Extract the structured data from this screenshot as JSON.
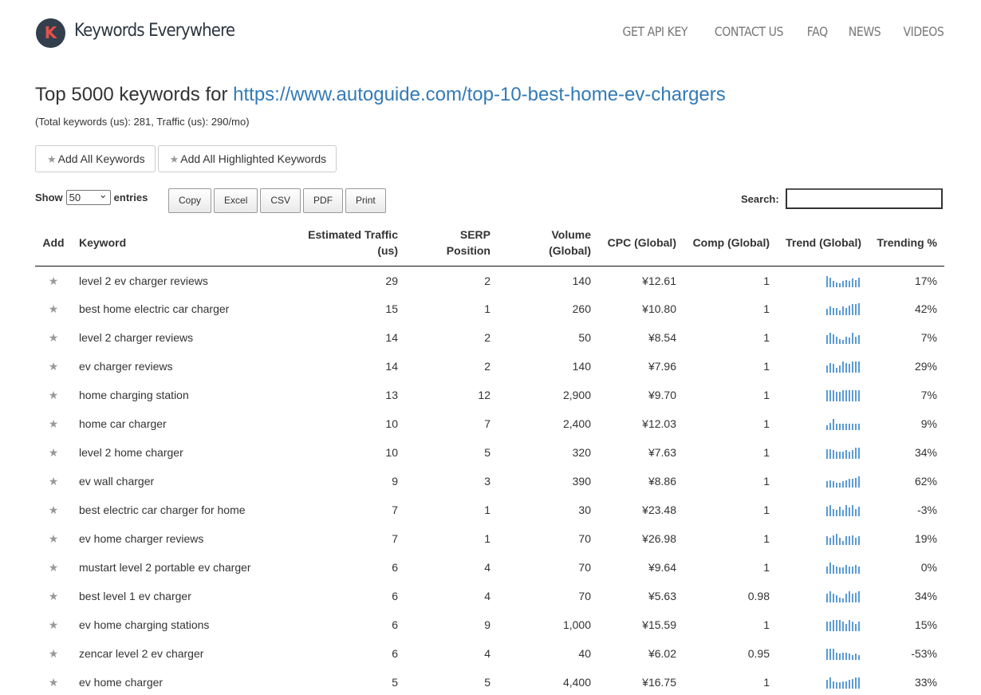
{
  "header": {
    "logo_letter": "K",
    "brand": "Keywords Everywhere",
    "nav": [
      "GET API KEY",
      "CONTACT US",
      "FAQ",
      "NEWS",
      "VIDEOS"
    ]
  },
  "title": {
    "prefix": "Top 5000 keywords for",
    "url": "https://www.autoguide.com/top-10-best-home-ev-chargers"
  },
  "subtitle": "(Total keywords (us): 281, Traffic (us): 290/mo)",
  "buttons": {
    "add_all": "Add All Keywords",
    "add_highlighted": "Add All Highlighted Keywords"
  },
  "show": {
    "prefix": "Show",
    "value": "50",
    "suffix": "entries"
  },
  "exports": [
    "Copy",
    "Excel",
    "CSV",
    "PDF",
    "Print"
  ],
  "search": {
    "label": "Search:",
    "value": ""
  },
  "table": {
    "headers": {
      "add": "Add",
      "keyword": "Keyword",
      "traffic_1": "Estimated Traffic",
      "traffic_2": "(us)",
      "serp_1": "SERP",
      "serp_2": "Position",
      "volume_1": "Volume",
      "volume_2": "(Global)",
      "cpc": "CPC (Global)",
      "comp": "Comp (Global)",
      "trend": "Trend (Global)",
      "trending": "Trending %"
    },
    "rows": [
      {
        "keyword": "level 2 ev charger reviews",
        "traffic": "29",
        "serp": "2",
        "volume": "140",
        "cpc": "¥12.61",
        "comp": "1",
        "trending": "17%",
        "trend": [
          0.9,
          0.8,
          0.5,
          0.4,
          0.3,
          0.5,
          0.6,
          0.5,
          0.7,
          0.6,
          0.8
        ]
      },
      {
        "keyword": "best home electric car charger",
        "traffic": "15",
        "serp": "1",
        "volume": "260",
        "cpc": "¥10.80",
        "comp": "1",
        "trending": "42%",
        "trend": [
          0.5,
          0.7,
          0.6,
          0.6,
          0.4,
          0.7,
          0.6,
          0.8,
          0.9,
          0.9,
          1.0
        ]
      },
      {
        "keyword": "level 2 charger reviews",
        "traffic": "14",
        "serp": "2",
        "volume": "50",
        "cpc": "¥8.54",
        "comp": "1",
        "trending": "7%",
        "trend": [
          0.7,
          0.9,
          0.8,
          0.6,
          0.4,
          0.3,
          0.6,
          0.5,
          0.9,
          0.6,
          0.7
        ]
      },
      {
        "keyword": "ev charger reviews",
        "traffic": "14",
        "serp": "2",
        "volume": "140",
        "cpc": "¥7.96",
        "comp": "1",
        "trending": "29%",
        "trend": [
          0.6,
          0.8,
          0.7,
          0.4,
          0.6,
          0.9,
          0.8,
          0.7,
          0.9,
          0.9,
          0.9
        ]
      },
      {
        "keyword": "home charging station",
        "traffic": "13",
        "serp": "12",
        "volume": "2,900",
        "cpc": "¥9.70",
        "comp": "1",
        "trending": "7%",
        "trend": [
          0.9,
          0.9,
          0.9,
          0.8,
          0.8,
          0.9,
          0.9,
          0.9,
          0.9,
          0.9,
          0.9
        ]
      },
      {
        "keyword": "home car charger",
        "traffic": "10",
        "serp": "7",
        "volume": "2,400",
        "cpc": "¥12.03",
        "comp": "1",
        "trending": "9%",
        "trend": [
          0.4,
          0.6,
          0.9,
          0.5,
          0.5,
          0.5,
          0.5,
          0.5,
          0.5,
          0.5,
          0.5
        ]
      },
      {
        "keyword": "level 2 home charger",
        "traffic": "10",
        "serp": "5",
        "volume": "320",
        "cpc": "¥7.63",
        "comp": "1",
        "trending": "34%",
        "trend": [
          0.8,
          0.8,
          0.7,
          0.6,
          0.6,
          0.6,
          0.7,
          0.6,
          0.7,
          0.9,
          0.9
        ]
      },
      {
        "keyword": "ev wall charger",
        "traffic": "9",
        "serp": "3",
        "volume": "390",
        "cpc": "¥8.86",
        "comp": "1",
        "trending": "62%",
        "trend": [
          0.5,
          0.6,
          0.5,
          0.4,
          0.4,
          0.5,
          0.6,
          0.7,
          0.7,
          0.8,
          0.9
        ]
      },
      {
        "keyword": "best electric car charger for home",
        "traffic": "7",
        "serp": "1",
        "volume": "30",
        "cpc": "¥23.48",
        "comp": "1",
        "trending": "-3%",
        "trend": [
          0.8,
          0.9,
          0.6,
          0.5,
          0.8,
          0.5,
          0.9,
          0.7,
          0.9,
          0.6,
          0.8
        ]
      },
      {
        "keyword": "ev home charger reviews",
        "traffic": "7",
        "serp": "1",
        "volume": "70",
        "cpc": "¥26.98",
        "comp": "1",
        "trending": "19%",
        "trend": [
          0.7,
          0.6,
          0.8,
          0.9,
          0.6,
          0.3,
          0.7,
          0.7,
          0.8,
          0.6,
          0.7
        ]
      },
      {
        "keyword": "mustart level 2 portable ev charger",
        "traffic": "6",
        "serp": "4",
        "volume": "70",
        "cpc": "¥9.64",
        "comp": "1",
        "trending": "0%",
        "trend": [
          0.6,
          0.9,
          0.7,
          0.6,
          0.5,
          0.5,
          0.7,
          0.6,
          0.6,
          0.7,
          0.6
        ]
      },
      {
        "keyword": "best level 1 ev charger",
        "traffic": "6",
        "serp": "4",
        "volume": "70",
        "cpc": "¥5.63",
        "comp": "0.98",
        "trending": "34%",
        "trend": [
          0.7,
          0.9,
          0.7,
          0.6,
          0.4,
          0.3,
          0.7,
          0.9,
          0.7,
          0.8,
          0.9
        ]
      },
      {
        "keyword": "ev home charging stations",
        "traffic": "6",
        "serp": "9",
        "volume": "1,000",
        "cpc": "¥15.59",
        "comp": "1",
        "trending": "15%",
        "trend": [
          0.8,
          0.8,
          0.9,
          0.9,
          0.9,
          0.8,
          0.6,
          0.9,
          0.8,
          0.6,
          0.8
        ]
      },
      {
        "keyword": "zencar level 2 ev charger",
        "traffic": "6",
        "serp": "4",
        "volume": "40",
        "cpc": "¥6.02",
        "comp": "0.95",
        "trending": "-53%",
        "trend": [
          0.9,
          0.9,
          0.9,
          0.6,
          0.5,
          0.6,
          0.6,
          0.5,
          0.4,
          0.5,
          0.4
        ]
      },
      {
        "keyword": "ev home charger",
        "traffic": "5",
        "serp": "5",
        "volume": "4,400",
        "cpc": "¥16.75",
        "comp": "1",
        "trending": "33%",
        "trend": [
          0.7,
          0.9,
          0.6,
          0.5,
          0.5,
          0.6,
          0.6,
          0.7,
          0.8,
          0.9,
          0.9
        ]
      }
    ]
  },
  "colors": {
    "link": "#337ab7",
    "trend_bar": "#5b9bd5",
    "logo_bg": "#333f4d",
    "logo_letter": "#e4524a"
  }
}
